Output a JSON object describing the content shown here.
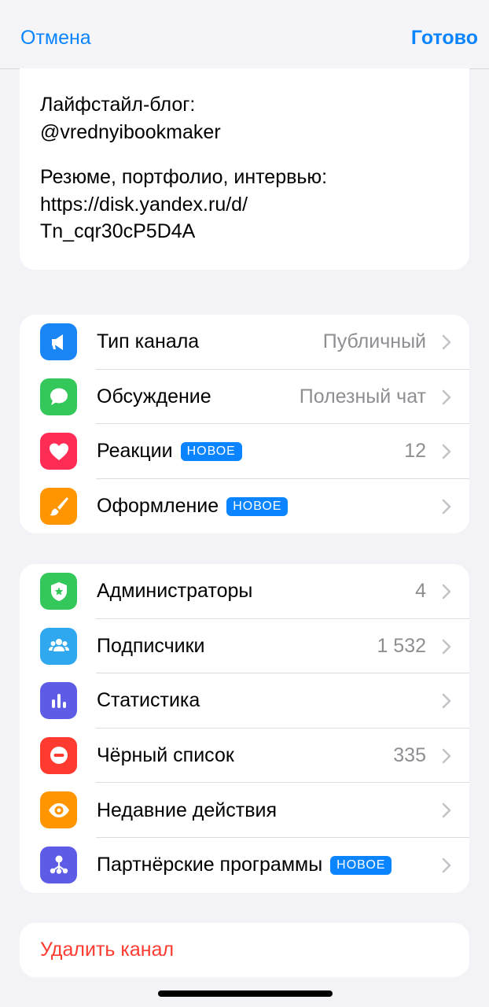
{
  "navbar": {
    "cancel": "Отмена",
    "done": "Готово"
  },
  "description": {
    "line1": "Лайфстайл-блог:",
    "line2": "@vrednyibookmaker",
    "line3": "Резюме, портфолио, интервью:",
    "line4": "https://disk.yandex.ru/d/",
    "line5": "Tn_cqr30cP5D4A"
  },
  "group1": [
    {
      "label": "Тип канала",
      "value": "Публичный",
      "icon": "megaphone-icon",
      "color": "#1a86f5"
    },
    {
      "label": "Обсуждение",
      "value": "Полезный чат",
      "icon": "speech-bubble-icon",
      "color": "#34c759"
    },
    {
      "label": "Реакции",
      "badge": "НОВОЕ",
      "value": "12",
      "icon": "heart-icon",
      "color": "#ff2d55"
    },
    {
      "label": "Оформление",
      "badge": "НОВОЕ",
      "value": "",
      "icon": "brush-icon",
      "color": "#ff9500"
    }
  ],
  "group2": [
    {
      "label": "Администраторы",
      "value": "4",
      "icon": "shield-star-icon",
      "color": "#34c759"
    },
    {
      "label": "Подписчики",
      "value": "1 532",
      "icon": "people-icon",
      "color": "#30a8f0"
    },
    {
      "label": "Статистика",
      "value": "",
      "icon": "bar-chart-icon",
      "color": "#5e5ce6"
    },
    {
      "label": "Чёрный список",
      "value": "335",
      "icon": "block-icon",
      "color": "#ff3b30"
    },
    {
      "label": "Недавние действия",
      "value": "",
      "icon": "eye-icon",
      "color": "#ff9500"
    },
    {
      "label": "Партнёрские программы",
      "badge": "НОВОЕ",
      "value": "",
      "icon": "affiliate-icon",
      "color": "#5e5ce6"
    }
  ],
  "delete_label": "Удалить канал"
}
